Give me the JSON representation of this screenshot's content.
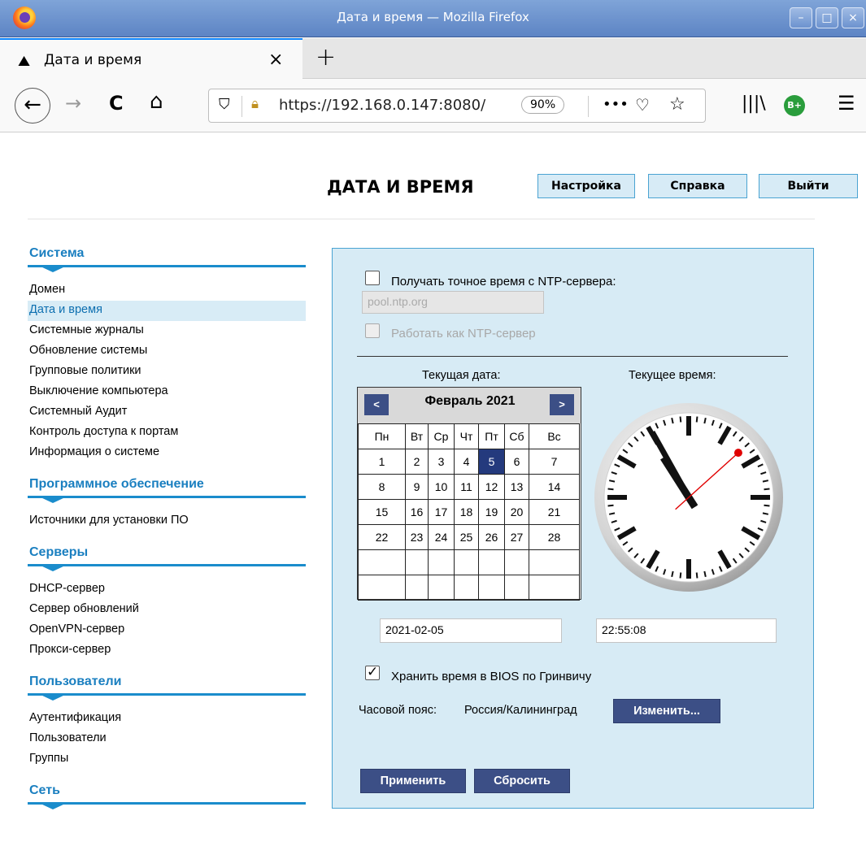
{
  "window": {
    "title": "Дата и время — Mozilla Firefox"
  },
  "tab": {
    "label": "Дата и время",
    "close": "×",
    "new_tab": "+"
  },
  "nav": {
    "back": "←",
    "forward": "→",
    "reload": "C",
    "home": "⌂",
    "url": "https://192.168.0.147:8080/",
    "zoom": "90%",
    "more": "•••"
  },
  "page": {
    "title": "ДАТА И ВРЕМЯ",
    "buttons": {
      "settings": "Настройка",
      "help": "Справка",
      "logout": "Выйти"
    }
  },
  "sidebar": {
    "sections": [
      {
        "title": "Система",
        "items": [
          {
            "label": "Домен"
          },
          {
            "label": "Дата и время",
            "active": true
          },
          {
            "label": "Системные журналы"
          },
          {
            "label": "Обновление системы"
          },
          {
            "label": "Групповые политики"
          },
          {
            "label": "Выключение компьютера"
          },
          {
            "label": "Системный Аудит"
          },
          {
            "label": "Контроль доступа к портам"
          },
          {
            "label": "Информация о системе"
          }
        ]
      },
      {
        "title": "Программное обеспечение",
        "items": [
          {
            "label": "Источники для установки ПО"
          }
        ]
      },
      {
        "title": "Серверы",
        "items": [
          {
            "label": "DHCP-сервер"
          },
          {
            "label": "Сервер обновлений"
          },
          {
            "label": "OpenVPN-сервер"
          },
          {
            "label": "Прокси-сервер"
          }
        ]
      },
      {
        "title": "Пользователи",
        "items": [
          {
            "label": "Аутентификация"
          },
          {
            "label": "Пользователи"
          },
          {
            "label": "Группы"
          }
        ]
      },
      {
        "title": "Сеть",
        "items": []
      }
    ]
  },
  "form": {
    "ntp_checkbox": {
      "label": "Получать точное время с NTP-сервера:",
      "checked": false
    },
    "ntp_server": {
      "placeholder": "pool.ntp.org"
    },
    "ntp_serve_checkbox": {
      "label": "Работать как NTP-сервер",
      "checked": false,
      "disabled": true
    },
    "current_date_label": "Текущая дата:",
    "current_time_label": "Текущее время:",
    "calendar": {
      "month_label": "Февраль 2021",
      "prev": "<",
      "next": ">",
      "weekdays": [
        "Пн",
        "Вт",
        "Ср",
        "Чт",
        "Пт",
        "Сб",
        "Вс"
      ],
      "weeks": [
        [
          "1",
          "2",
          "3",
          "4",
          "5",
          "6",
          "7"
        ],
        [
          "8",
          "9",
          "10",
          "11",
          "12",
          "13",
          "14"
        ],
        [
          "15",
          "16",
          "17",
          "18",
          "19",
          "20",
          "21"
        ],
        [
          "22",
          "23",
          "24",
          "25",
          "26",
          "27",
          "28"
        ],
        [
          "",
          "",
          "",
          "",
          "",
          "",
          ""
        ],
        [
          "",
          "",
          "",
          "",
          "",
          "",
          ""
        ]
      ],
      "selected": "5"
    },
    "clock": {
      "hours": 22,
      "minutes": 55,
      "seconds": 8,
      "second_hand_color": "#e00000"
    },
    "date_value": "2021-02-05",
    "time_value": "22:55:08",
    "bios_checkbox": {
      "label": "Хранить время в BIOS по Гринвичу",
      "checked": true
    },
    "timezone_label": "Часовой пояс:",
    "timezone_value": "Россия/Калининград",
    "change_button": "Изменить...",
    "apply_button": "Применить",
    "reset_button": "Сбросить"
  },
  "colors": {
    "accent": "#1a8ccc",
    "panel_bg": "#d7ebf5",
    "button_dark": "#3c4f86",
    "selected_day": "#243a7d"
  }
}
